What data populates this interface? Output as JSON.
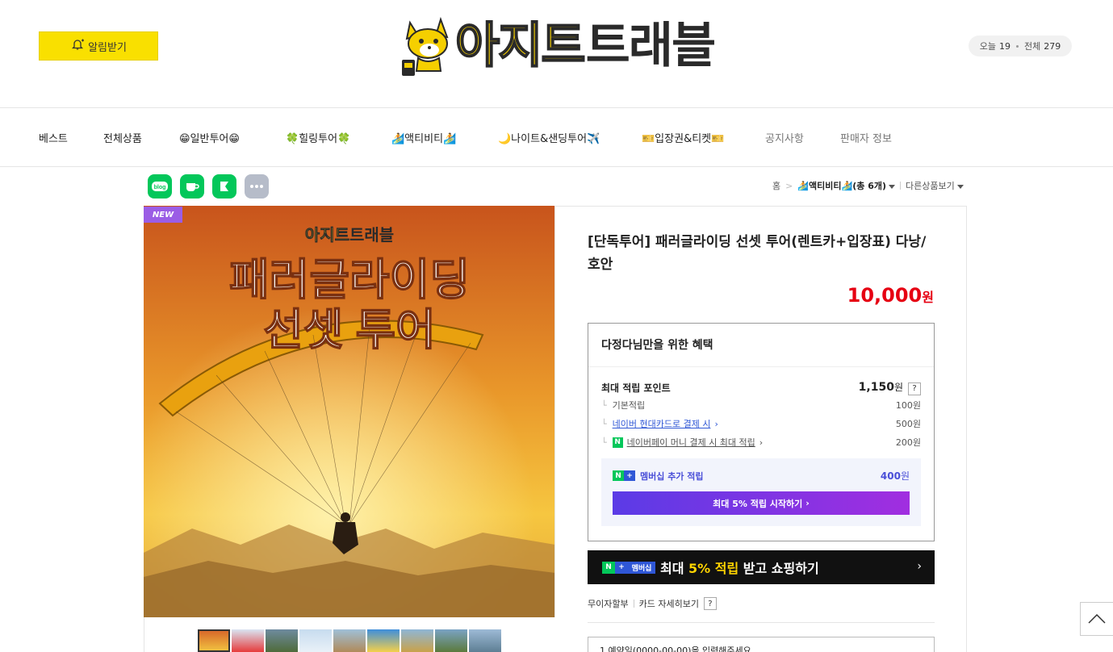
{
  "header": {
    "alarm_label": "알림받기",
    "logo_text_1": "아지트",
    "logo_text_2": "트래블",
    "visitor_today_label": "오늘",
    "visitor_today": "19",
    "visitor_total_label": "전체",
    "visitor_total": "279"
  },
  "nav": {
    "items": [
      "베스트",
      "전체상품",
      "😁일반투어😁",
      "🍀힐링투어🍀",
      "🏄액티비티🏄",
      "🌙나이트&샌딩투어✈️",
      "🎫입장권&티켓🎫",
      "공지사항",
      "판매자 정보"
    ]
  },
  "share": [
    "blog",
    "cafe",
    "band",
    "more"
  ],
  "breadcrumb": {
    "home": "홈",
    "sep": ">",
    "category": "🏄액티비티🏄(총 6개)",
    "other": "다른상품보기"
  },
  "product": {
    "badge": "NEW",
    "image_brand_1": "아지트",
    "image_brand_2": "트래블",
    "image_line_1": "패러글라이딩",
    "image_line_2": "선셋 투어",
    "title": "[단독투어] 패러글라이딩 선셋 투어(렌트카+입장표) 다낭/호안",
    "price": "10,000",
    "price_unit": "원"
  },
  "benefit": {
    "title": "다정다님만을 위한 혜택",
    "max_point_label": "최대 적립 포인트",
    "max_point_value": "1,150",
    "won": "원",
    "q": "?",
    "basic_label": "기본적립",
    "basic_value": "100원",
    "card_label": "네이버 현대카드로 결제 시",
    "card_value": "500원",
    "npay_label": "네이버페이 머니 결제 시 최대 적립",
    "npay_value": "200원",
    "membership_label": "멤버십 추가 적립",
    "membership_value": "400",
    "membership_btn": "최대 5% 적립 시작하기"
  },
  "banner": {
    "badge": "멤버십",
    "text_1": "최대",
    "text_hl": "5% 적립",
    "text_2": "받고 쇼핑하기"
  },
  "pay": {
    "installment": "무이자할부",
    "card_detail": "카드 자세히보기",
    "q": "?",
    "date_placeholder": "1.예약일(0000-00-00)을 입력해주세요"
  },
  "colors": {
    "brand_yellow": "#f9e000",
    "price_red": "#e60012",
    "naver_green": "#03c75a",
    "membership_purple": "#5b3be6"
  }
}
